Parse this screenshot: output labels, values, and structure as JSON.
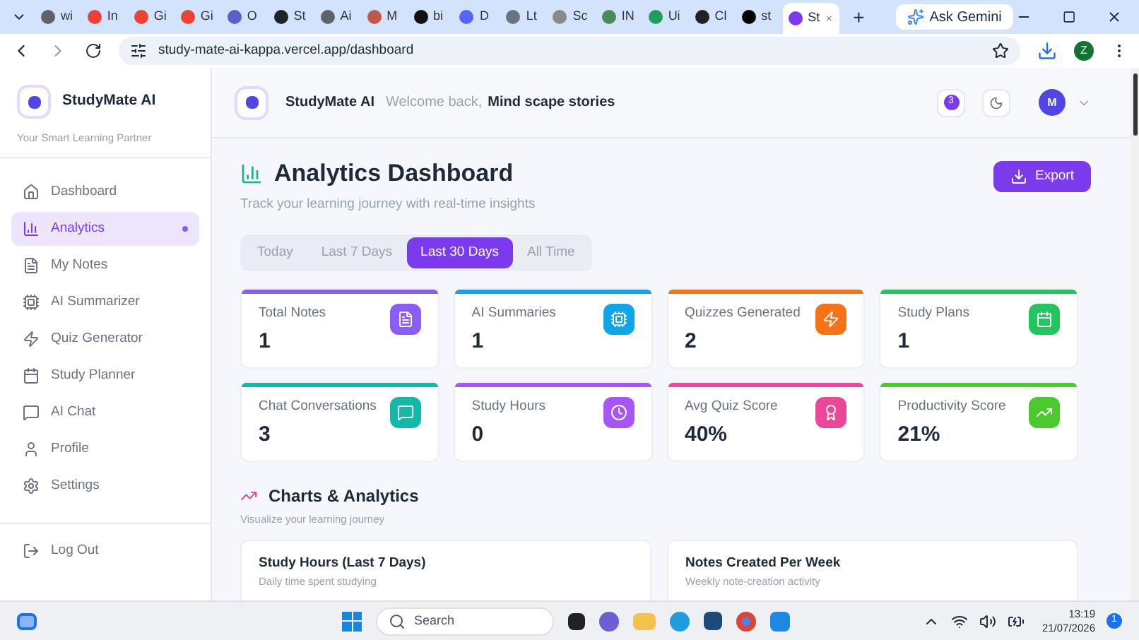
{
  "browser": {
    "tabs": [
      {
        "label": "wi",
        "color": "#5f6368",
        "selected": false
      },
      {
        "label": "In",
        "color": "#ea4335",
        "selected": false
      },
      {
        "label": "Gi",
        "color": "#ea4335",
        "selected": false
      },
      {
        "label": "Gi",
        "color": "#ea4335",
        "selected": false
      },
      {
        "label": "O",
        "color": "#5b5fc7",
        "selected": false
      },
      {
        "label": "St",
        "color": "#1f2328",
        "selected": false
      },
      {
        "label": "Ai",
        "color": "#5f6368",
        "selected": false
      },
      {
        "label": "M",
        "color": "#c0584a",
        "selected": false
      },
      {
        "label": "bi",
        "color": "#111111",
        "selected": false
      },
      {
        "label": "D",
        "color": "#5865f2",
        "selected": false
      },
      {
        "label": "Lt",
        "color": "#6b7280",
        "selected": false
      },
      {
        "label": "Sc",
        "color": "#8a8a8a",
        "selected": false
      },
      {
        "label": "IN",
        "color": "#4b8b5a",
        "selected": false
      },
      {
        "label": "Ui",
        "color": "#1e9e5a",
        "selected": false
      },
      {
        "label": "Cl",
        "color": "#222222",
        "selected": false
      },
      {
        "label": "st",
        "color": "#000000",
        "selected": false
      },
      {
        "label": "St",
        "color": "#7c3aed",
        "selected": true
      }
    ],
    "new_tab": "+",
    "ask": "Ask Gemini",
    "url": "study-mate-ai-kappa.vercel.app/dashboard",
    "profile": "Z"
  },
  "sidebar": {
    "brand": "StudyMate AI",
    "tagline": "Your Smart Learning Partner",
    "items": [
      {
        "label": "Dashboard",
        "selected": false
      },
      {
        "label": "Analytics",
        "selected": true
      },
      {
        "label": "My Notes",
        "selected": false
      },
      {
        "label": "AI Summarizer",
        "selected": false
      },
      {
        "label": "Quiz Generator",
        "selected": false
      },
      {
        "label": "Study Planner",
        "selected": false
      },
      {
        "label": "AI Chat",
        "selected": false
      },
      {
        "label": "Profile",
        "selected": false
      },
      {
        "label": "Settings",
        "selected": false
      }
    ],
    "logout": "Log Out"
  },
  "header": {
    "brand": "StudyMate AI",
    "welcome": "Welcome back,",
    "user": "Mind scape stories",
    "notifications": "3",
    "avatar": "M"
  },
  "page": {
    "title": "Analytics Dashboard",
    "subtitle": "Track your learning journey with real-time insights",
    "export": "Export",
    "periods": [
      {
        "label": "Today",
        "selected": false
      },
      {
        "label": "Last 7 Days",
        "selected": false
      },
      {
        "label": "Last 30 Days",
        "selected": true
      },
      {
        "label": "All Time",
        "selected": false
      }
    ],
    "stats": [
      {
        "label": "Total Notes",
        "value": "1",
        "color": "#8b5cf6"
      },
      {
        "label": "AI Summaries",
        "value": "1",
        "color": "#0ea5e9"
      },
      {
        "label": "Quizzes Generated",
        "value": "2",
        "color": "#f97316"
      },
      {
        "label": "Study Plans",
        "value": "1",
        "color": "#22c55e"
      },
      {
        "label": "Chat Conversations",
        "value": "3",
        "color": "#14b8a6"
      },
      {
        "label": "Study Hours",
        "value": "0",
        "color": "#a855f7"
      },
      {
        "label": "Avg Quiz Score",
        "value": "40%",
        "color": "#ec4899"
      },
      {
        "label": "Productivity Score",
        "value": "21%",
        "color": "#4cc92e"
      }
    ],
    "charts_title": "Charts & Analytics",
    "charts_subtitle": "Visualize your learning journey",
    "chart_cards": [
      {
        "title": "Study Hours (Last 7 Days)",
        "subtitle": "Daily time spent studying"
      },
      {
        "title": "Notes Created Per Week",
        "subtitle": "Weekly note-creation activity"
      }
    ]
  },
  "taskbar": {
    "search": "Search",
    "time": "13:19",
    "date": "21/07/2026",
    "badge": "1"
  }
}
